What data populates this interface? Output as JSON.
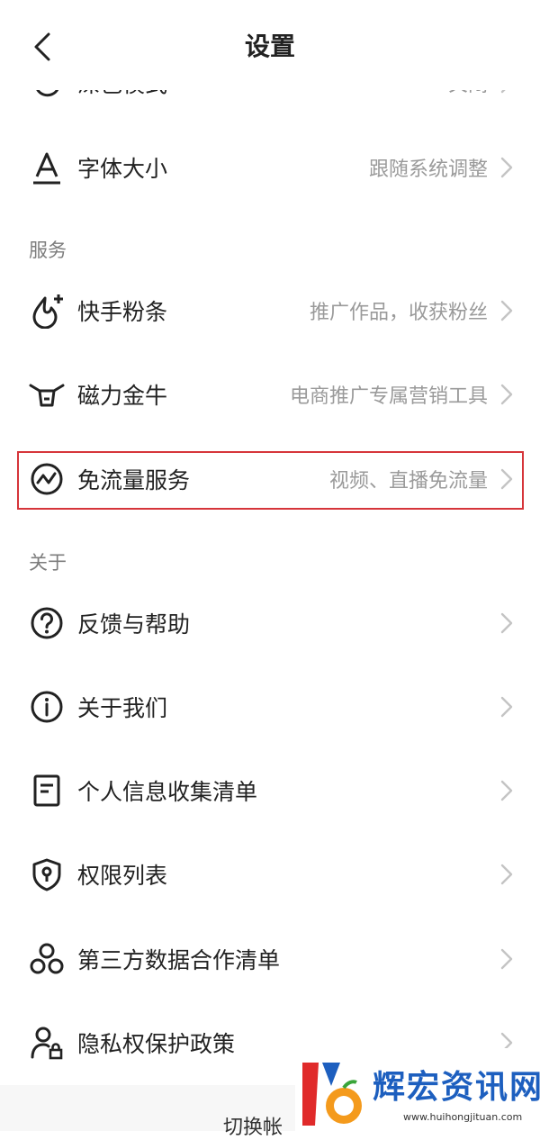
{
  "header": {
    "title": "设置"
  },
  "items_top": [
    {
      "label": "深色模式",
      "sub": "关闭",
      "icon": "moon-icon"
    },
    {
      "label": "字体大小",
      "sub": "跟随系统调整",
      "icon": "font-a-icon"
    }
  ],
  "sections": {
    "service": "服务",
    "about": "关于"
  },
  "service_items": [
    {
      "label": "快手粉条",
      "sub": "推广作品，收获粉丝",
      "icon": "fire-plus-icon"
    },
    {
      "label": "磁力金牛",
      "sub": "电商推广专属营销工具",
      "icon": "bull-icon"
    },
    {
      "label": "免流量服务",
      "sub": "视频、直播免流量",
      "icon": "wave-circle-icon"
    }
  ],
  "about_items": [
    {
      "label": "反馈与帮助",
      "sub": "",
      "icon": "question-circle-icon"
    },
    {
      "label": "关于我们",
      "sub": "",
      "icon": "info-circle-icon"
    },
    {
      "label": "个人信息收集清单",
      "sub": "",
      "icon": "document-icon"
    },
    {
      "label": "权限列表",
      "sub": "",
      "icon": "shield-key-icon"
    },
    {
      "label": "第三方数据合作清单",
      "sub": "",
      "icon": "three-circles-icon"
    },
    {
      "label": "隐私权保护政策",
      "sub": "",
      "icon": "user-lock-icon"
    }
  ],
  "bottom_partial": "切换帐",
  "watermark": {
    "text": "辉宏资讯网",
    "url": "www.huihongjituan.com"
  },
  "colors": {
    "highlight": "#d6353a",
    "dot": "#e0407a",
    "sub_text": "#9a9a9a",
    "watermark": "#1d5fbf"
  }
}
